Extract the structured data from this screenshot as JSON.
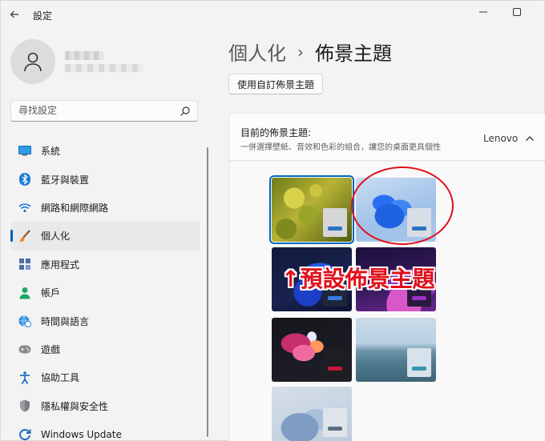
{
  "window": {
    "title": "設定",
    "back_icon": "back-arrow-icon",
    "minimize_icon": "minimize-icon",
    "maximize_icon": "maximize-icon"
  },
  "search": {
    "placeholder": "尋找設定",
    "icon": "search-icon"
  },
  "sidebar": {
    "items": [
      {
        "label": "系統",
        "icon": "system-monitor-icon",
        "active": false
      },
      {
        "label": "藍牙與裝置",
        "icon": "bluetooth-icon",
        "active": false
      },
      {
        "label": "網路和網際網路",
        "icon": "wifi-icon",
        "active": false
      },
      {
        "label": "個人化",
        "icon": "paintbrush-icon",
        "active": true
      },
      {
        "label": "應用程式",
        "icon": "apps-grid-icon",
        "active": false
      },
      {
        "label": "帳戶",
        "icon": "account-person-icon",
        "active": false
      },
      {
        "label": "時間與語言",
        "icon": "globe-clock-icon",
        "active": false
      },
      {
        "label": "遊戲",
        "icon": "gamepad-icon",
        "active": false
      },
      {
        "label": "協助工具",
        "icon": "accessibility-icon",
        "active": false
      },
      {
        "label": "隱私權與安全性",
        "icon": "shield-icon",
        "active": false
      },
      {
        "label": "Windows Update",
        "icon": "windows-update-icon",
        "active": false
      }
    ]
  },
  "main": {
    "breadcrumb": {
      "parent": "個人化",
      "separator": "›",
      "current": "佈景主題"
    },
    "custom_theme_button": "使用自訂佈景主題",
    "current_theme": {
      "title": "目前的佈景主題:",
      "subtitle": "一併選擇壁紙、音效和色彩的組合，讓您的桌面更具個性",
      "value": "Lenovo"
    },
    "themes": [
      {
        "name": "lenovo-theme",
        "selected": true,
        "mini_bg": "#d6d6d8",
        "bar": "#2a73c4"
      },
      {
        "name": "windows-light-theme",
        "selected": false,
        "mini_bg": "#d9dde6",
        "bar": "#2a73c4"
      },
      {
        "name": "windows-dark-theme",
        "selected": false,
        "mini_bg": "#20263a",
        "bar": "#3a7be0"
      },
      {
        "name": "glow-theme",
        "selected": false,
        "mini_bg": "#2a1a3e",
        "bar": "#9b33c4"
      },
      {
        "name": "captured-motion-theme",
        "selected": false,
        "mini_bg": "#1e1e22",
        "bar": "#c4173b"
      },
      {
        "name": "flow-theme",
        "selected": false,
        "mini_bg": "#d8e2ea",
        "bar": "#3a95b0"
      },
      {
        "name": "sunrise-theme",
        "selected": false,
        "mini_bg": "#dfe4ea",
        "bar": "#5c6e80"
      }
    ],
    "annotation": "↑預設佈景主題"
  },
  "colors": {
    "accent": "#005fb8",
    "annotation_red": "#e00f1a",
    "background": "#f3f3f3"
  }
}
